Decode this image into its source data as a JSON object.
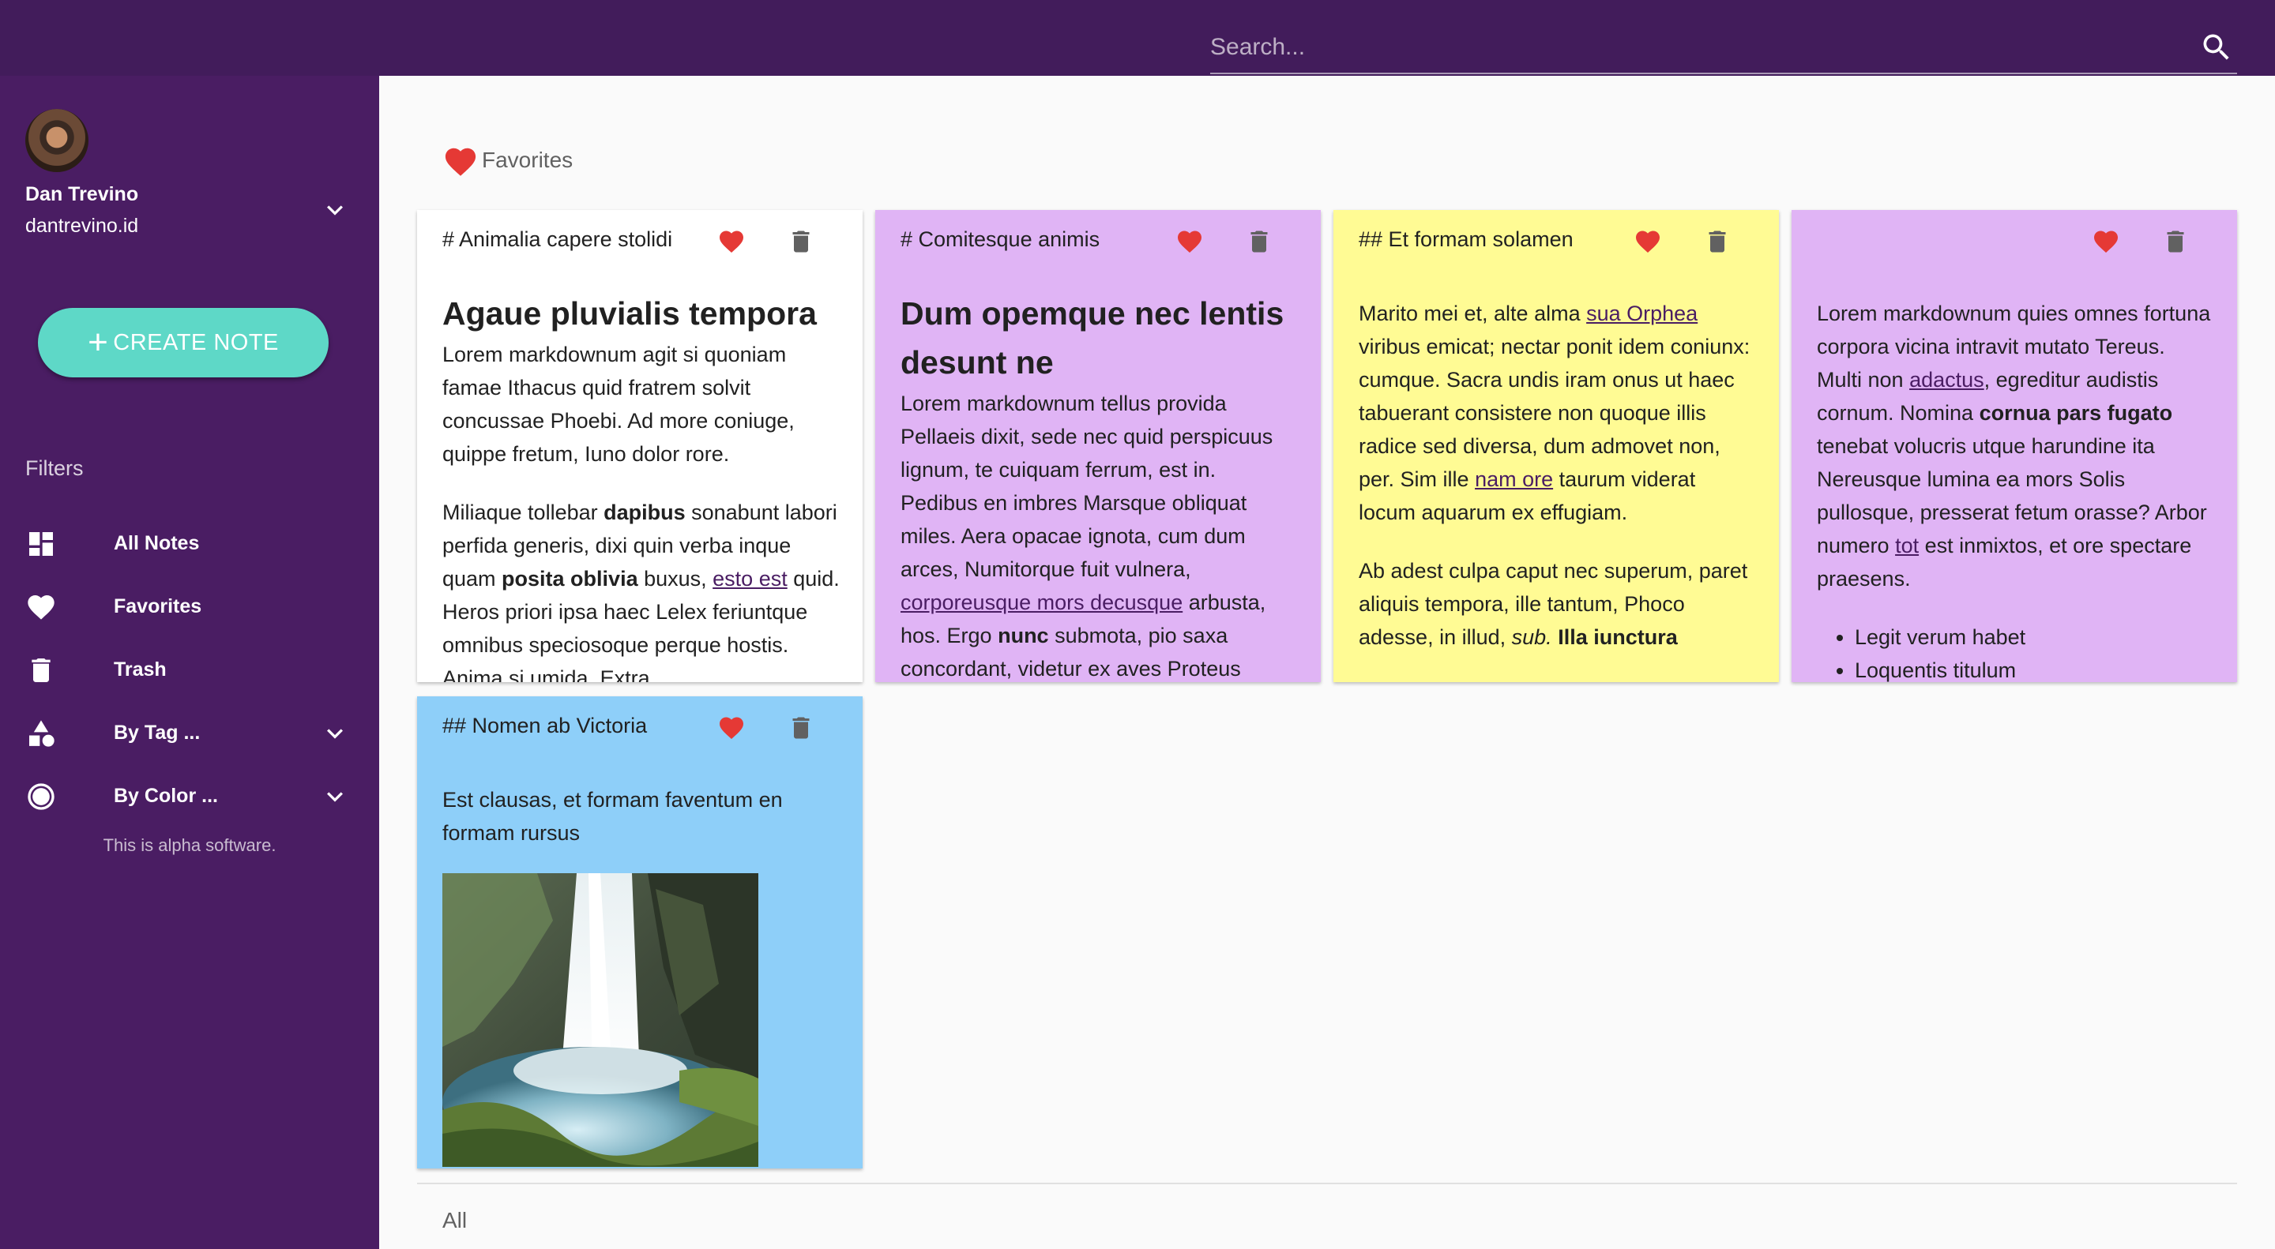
{
  "search": {
    "placeholder": "Search..."
  },
  "user": {
    "name": "Dan Trevino",
    "id": "dantrevino.id"
  },
  "sidebar": {
    "create_label": "CREATE NOTE",
    "filters_label": "Filters",
    "items": [
      {
        "label": "All Notes",
        "icon": "dashboard-icon"
      },
      {
        "label": "Favorites",
        "icon": "heart-icon"
      },
      {
        "label": "Trash",
        "icon": "trash-icon"
      },
      {
        "label": "By Tag ...",
        "icon": "shapes-icon"
      },
      {
        "label": "By Color ...",
        "icon": "circle-icon"
      }
    ],
    "footer": "This is alpha software."
  },
  "main": {
    "favorites_label": "Favorites",
    "all_label": "All"
  },
  "colors": {
    "topbar": "#421c5b",
    "sidebar": "#4a1d63",
    "create_button": "#5ed8c7",
    "heart": "#e53935",
    "card_white": "#ffffff",
    "card_purple": "#e0b4f5",
    "card_yellow": "#fffb94",
    "card_blue": "#8ecff9"
  },
  "cards": [
    {
      "title": "# Animalia capere stolidi",
      "color": "#ffffff",
      "heading": "Agaue pluvialis tempora",
      "p1": "Lorem markdownum agit si quoniam famae Ithacus quid fratrem solvit concussae Phoebi. Ad more coniuge, quippe fretum, Iuno dolor rore.",
      "p2_a": "Miliaque tollebar ",
      "p2_b": "dapibus",
      "p2_c": " sonabunt labori perfida generis, dixi quin verba inque quam ",
      "p2_d": "posita oblivia",
      "p2_e": " buxus, ",
      "p2_link": "esto est",
      "p2_f": " quid. Heros priori ipsa haec Lelex feriuntque omnibus speciosoque perque hostis. Anima si umida. Extra"
    },
    {
      "title": "# Comitesque animis",
      "color": "#e0b4f5",
      "heading": "Dum opemque nec lentis desunt ne",
      "p1_a": "Lorem markdownum tellus provida Pellaeis dixit, sede nec quid perspicuus lignum, te cuiquam ferrum, est in. Pedibus en imbres Marsque obliquat miles. Aera opacae ignota, cum dum arces, Numitorque fuit vulnera, ",
      "p1_link": "corporeusque mors decusque",
      "p1_b": " arbusta, hos. Ergo ",
      "p1_bold": "nunc",
      "p1_c": " submota, pio saxa concordant, videtur ex aves Proteus"
    },
    {
      "title": "## Et formam solamen",
      "color": "#fffb94",
      "p1_a": "Marito mei et, alte alma ",
      "p1_link1": "sua Orphea",
      "p1_b": " viribus emicat; nectar ponit idem coniunx: cumque. Sacra undis iram onus ut haec tabuerant consistere non quoque illis radice sed diversa, dum admovet non, per. Sim ille ",
      "p1_link2": "nam ore",
      "p1_c": " taurum viderat locum aquarum ex effugiam.",
      "p2_a": "Ab adest culpa caput nec superum, paret aliquis tempora, ille tantum, Phoco adesse, in illud, ",
      "p2_italic": "sub.",
      "p2_b": " ",
      "p2_bold": "Illa iunctura"
    },
    {
      "title": "",
      "color": "#e0b4f5",
      "p1_a": "Lorem markdownum quies omnes fortuna corpora vicina intravit mutato Tereus. Multi non ",
      "p1_link1": "adactus",
      "p1_b": ", egreditur audistis cornum. Nomina ",
      "p1_bold": "cornua pars fugato",
      "p1_c": " tenebat volucris utque harundine ita Nereusque lumina ea mors Solis pullosque, presserat fetum orasse? Arbor numero ",
      "p1_link2": "tot",
      "p1_d": " est inmixtos, et ore spectare praesens.",
      "list": [
        "Legit verum habet",
        "Loquentis titulum"
      ]
    },
    {
      "title": "## Nomen ab Victoria",
      "color": "#8ecff9",
      "p1": "Est clausas, et formam faventum en formam rursus"
    }
  ]
}
